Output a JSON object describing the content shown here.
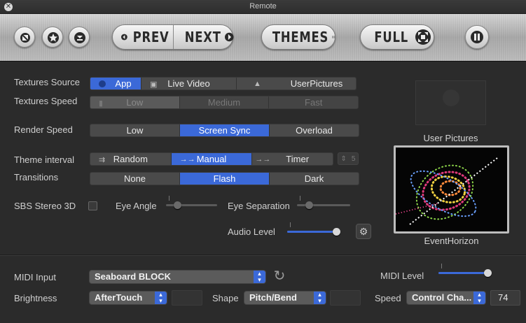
{
  "window": {
    "title": "Remote"
  },
  "toolbar": {
    "prev_label": "PREV",
    "next_label": "NEXT",
    "themes_label": "THEMES",
    "full_label": "FULL"
  },
  "textures_source": {
    "label": "Textures Source",
    "options": [
      "App",
      "Live Video",
      "UserPictures"
    ],
    "selected": "App"
  },
  "textures_speed": {
    "label": "Textures Speed",
    "options": [
      "Low",
      "Medium",
      "Fast"
    ],
    "selected": "Low"
  },
  "render_speed": {
    "label": "Render Speed",
    "options": [
      "Low",
      "Screen Sync",
      "Overload"
    ],
    "selected": "Screen Sync"
  },
  "theme_interval": {
    "label": "Theme interval",
    "options": [
      "Random",
      "Manual",
      "Timer"
    ],
    "selected": "Manual",
    "timer_value": "5"
  },
  "transitions": {
    "label": "Transitions",
    "options": [
      "None",
      "Flash",
      "Dark"
    ],
    "selected": "Flash"
  },
  "sbs": {
    "label": "SBS Stereo 3D",
    "checked": false,
    "eye_angle_label": "Eye Angle",
    "eye_angle_level": 0.18,
    "eye_separation_label": "Eye Separation",
    "eye_separation_level": 0.18
  },
  "audio": {
    "label": "Audio Level",
    "level": 1.0
  },
  "thumbnails": {
    "user_pictures_caption": "User Pictures",
    "selected_caption": "EventHorizon"
  },
  "midi": {
    "input_label": "MIDI Input",
    "input_value": "Seaboard BLOCK",
    "level_label": "MIDI Level",
    "level": 1.0,
    "brightness_label": "Brightness",
    "brightness_value": "AfterTouch",
    "shape_label": "Shape",
    "shape_value": "Pitch/Bend",
    "speed_label": "Speed",
    "speed_value": "Control Cha...",
    "speed_number": "74"
  },
  "colors": {
    "accent": "#3b69d8",
    "background": "#2b2b2b"
  }
}
